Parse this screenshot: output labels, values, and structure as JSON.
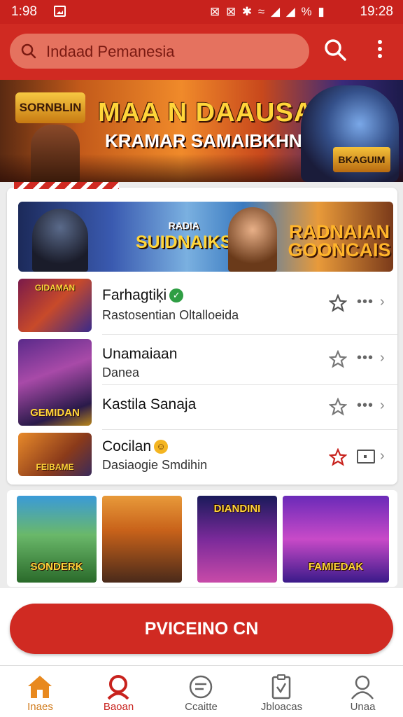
{
  "status_bar": {
    "time_left": "1:98",
    "icons": "⊠ ⊠ ✱ ≈ ◢ ◢ % ▮",
    "time_right": "19:28"
  },
  "header": {
    "search_placeholder": "Indaad Pemanesia"
  },
  "hero": {
    "logo": "SORNBLIN",
    "title": "MAA N DAAUSA",
    "subtitle": "KRAMAR SAMAIBKHN",
    "badge": "BKAGUIM"
  },
  "card": {
    "banner_left": "SUIDNAIKS",
    "banner_left_sub": "RADIA",
    "banner_right": "RADNAIAN GOONCAIS",
    "rows": [
      {
        "name": "Farhagtiķi",
        "sub": "Rastosentian Oltalloeida",
        "thumb_label": "GIDAMAN"
      },
      {
        "name": "Unamaiaan",
        "sub": "Danea",
        "thumb_label": "GEMIDAN"
      },
      {
        "name": "Kastila Sanaja",
        "sub": "",
        "thumb_label": ""
      },
      {
        "name": "Cocilan",
        "sub": "Dasiaogie Smdihin",
        "thumb_label": "FEIBAME"
      }
    ]
  },
  "games": [
    {
      "label": "SONDERK"
    },
    {
      "label": ""
    },
    {
      "label": "DIANDINI"
    },
    {
      "label": "FAMIEDAK"
    }
  ],
  "cta": {
    "label": "PVICEINO CN"
  },
  "nav": [
    {
      "label": "Inaes",
      "icon": "home-icon"
    },
    {
      "label": "Baoan",
      "icon": "user-search-icon"
    },
    {
      "label": "Ccaitte",
      "icon": "chat-icon"
    },
    {
      "label": "Jbloacas",
      "icon": "clipboard-icon"
    },
    {
      "label": "Unaa",
      "icon": "profile-icon"
    }
  ],
  "colors": {
    "primary": "#d02a22",
    "active_nav": "#e8891f"
  }
}
